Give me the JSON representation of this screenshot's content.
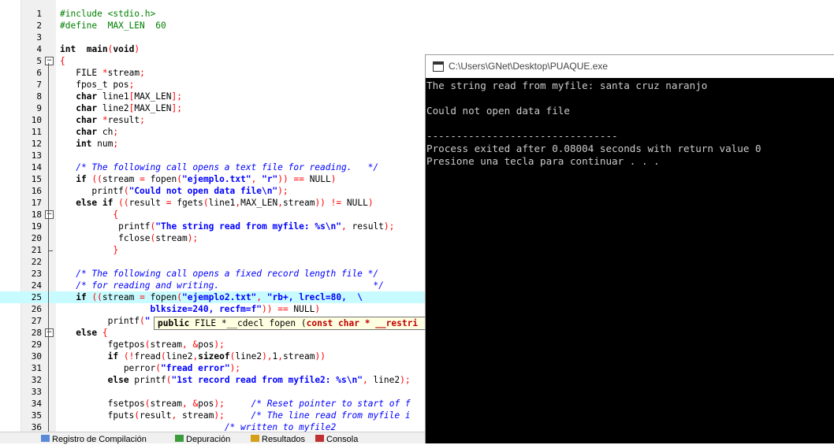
{
  "editor": {
    "lines": [
      {
        "n": "1",
        "segs": [
          [
            "pp",
            "#include <stdio.h>"
          ]
        ]
      },
      {
        "n": "2",
        "segs": [
          [
            "pp",
            "#define  MAX_LEN  60"
          ]
        ]
      },
      {
        "n": "3",
        "segs": []
      },
      {
        "n": "4",
        "segs": [
          [
            "kw",
            "int"
          ],
          [
            "",
            "  "
          ],
          [
            "kw",
            "main"
          ],
          [
            "sym",
            "("
          ],
          [
            "kw",
            "void"
          ],
          [
            "sym",
            ")"
          ]
        ]
      },
      {
        "n": "5",
        "segs": [
          [
            "sym",
            "{"
          ]
        ]
      },
      {
        "n": "6",
        "segs": [
          [
            "",
            "   FILE "
          ],
          [
            "sym",
            "*"
          ],
          [
            "",
            "stream"
          ],
          [
            "sym",
            ";"
          ]
        ]
      },
      {
        "n": "7",
        "segs": [
          [
            "",
            "   fpos_t pos"
          ],
          [
            "sym",
            ";"
          ]
        ]
      },
      {
        "n": "8",
        "segs": [
          [
            "kw",
            "   char"
          ],
          [
            "",
            " line1"
          ],
          [
            "sym",
            "["
          ],
          [
            "",
            "MAX_LEN"
          ],
          [
            "sym",
            "];"
          ]
        ]
      },
      {
        "n": "9",
        "segs": [
          [
            "kw",
            "   char"
          ],
          [
            "",
            " line2"
          ],
          [
            "sym",
            "["
          ],
          [
            "",
            "MAX_LEN"
          ],
          [
            "sym",
            "];"
          ]
        ]
      },
      {
        "n": "10",
        "segs": [
          [
            "kw",
            "   char"
          ],
          [
            "",
            " "
          ],
          [
            "sym",
            "*"
          ],
          [
            "",
            "result"
          ],
          [
            "sym",
            ";"
          ]
        ]
      },
      {
        "n": "11",
        "segs": [
          [
            "kw",
            "   char"
          ],
          [
            "",
            " ch"
          ],
          [
            "sym",
            ";"
          ]
        ]
      },
      {
        "n": "12",
        "segs": [
          [
            "kw",
            "   int"
          ],
          [
            "",
            " num"
          ],
          [
            "sym",
            ";"
          ]
        ]
      },
      {
        "n": "13",
        "segs": []
      },
      {
        "n": "14",
        "segs": [
          [
            "cm",
            "   /* The following call opens a text file for reading.   */"
          ]
        ]
      },
      {
        "n": "15",
        "segs": [
          [
            "kw",
            "   if"
          ],
          [
            "",
            " "
          ],
          [
            "sym",
            "(("
          ],
          [
            "",
            "stream "
          ],
          [
            "sym",
            "="
          ],
          [
            "",
            " fopen"
          ],
          [
            "sym",
            "("
          ],
          [
            "str",
            "\"ejemplo.txt\""
          ],
          [
            "sym",
            ","
          ],
          [
            "",
            " "
          ],
          [
            "str",
            "\"r\""
          ],
          [
            "sym",
            "))"
          ],
          [
            "",
            " "
          ],
          [
            "sym",
            "=="
          ],
          [
            "",
            " NULL"
          ],
          [
            "sym",
            ")"
          ]
        ]
      },
      {
        "n": "16",
        "segs": [
          [
            "",
            "      printf"
          ],
          [
            "sym",
            "("
          ],
          [
            "str",
            "\"Could not open data file\\n\""
          ],
          [
            "sym",
            ");"
          ]
        ]
      },
      {
        "n": "17",
        "segs": [
          [
            "kw",
            "   else if"
          ],
          [
            "",
            " "
          ],
          [
            "sym",
            "(("
          ],
          [
            "",
            "result "
          ],
          [
            "sym",
            "="
          ],
          [
            "",
            " fgets"
          ],
          [
            "sym",
            "("
          ],
          [
            "",
            "line1"
          ],
          [
            "sym",
            ","
          ],
          [
            "",
            "MAX_LEN"
          ],
          [
            "sym",
            ","
          ],
          [
            "",
            "stream"
          ],
          [
            "sym",
            "))"
          ],
          [
            "",
            " "
          ],
          [
            "sym",
            "!="
          ],
          [
            "",
            " NULL"
          ],
          [
            "sym",
            ")"
          ]
        ]
      },
      {
        "n": "18",
        "segs": [
          [
            "",
            "          "
          ],
          [
            "sym",
            "{"
          ]
        ]
      },
      {
        "n": "19",
        "segs": [
          [
            "",
            "           printf"
          ],
          [
            "sym",
            "("
          ],
          [
            "str",
            "\"The string read from myfile: %s\\n\""
          ],
          [
            "sym",
            ","
          ],
          [
            "",
            " result"
          ],
          [
            "sym",
            ");"
          ]
        ]
      },
      {
        "n": "20",
        "segs": [
          [
            "",
            "           fclose"
          ],
          [
            "sym",
            "("
          ],
          [
            "",
            "stream"
          ],
          [
            "sym",
            ");"
          ]
        ]
      },
      {
        "n": "21",
        "segs": [
          [
            "",
            "          "
          ],
          [
            "sym",
            "}"
          ]
        ]
      },
      {
        "n": "22",
        "segs": []
      },
      {
        "n": "23",
        "segs": [
          [
            "cm",
            "   /* The following call opens a fixed record length file */"
          ]
        ]
      },
      {
        "n": "24",
        "segs": [
          [
            "cm",
            "   /* for reading and writing.                             */"
          ]
        ]
      },
      {
        "n": "25",
        "segs": [
          [
            "kw",
            "   if"
          ],
          [
            "",
            " "
          ],
          [
            "sym",
            "(("
          ],
          [
            "",
            "stream "
          ],
          [
            "sym",
            "="
          ],
          [
            "",
            " fopen"
          ],
          [
            "sym",
            "("
          ],
          [
            "str",
            "\"ejemplo2.txt\""
          ],
          [
            "sym",
            ","
          ],
          [
            "",
            " "
          ],
          [
            "str",
            "\"rb+, lrecl=80,  \\"
          ]
        ]
      },
      {
        "n": "26",
        "segs": [
          [
            "",
            "                 "
          ],
          [
            "str",
            "blksize=240, recfm=f\""
          ],
          [
            "sym",
            "))"
          ],
          [
            "",
            " "
          ],
          [
            "sym",
            "=="
          ],
          [
            "",
            " NULL"
          ],
          [
            "sym",
            ")"
          ]
        ]
      },
      {
        "n": "27",
        "segs": [
          [
            "",
            "         printf"
          ],
          [
            "sym",
            "("
          ],
          [
            "str",
            "\""
          ]
        ]
      },
      {
        "n": "28",
        "segs": [
          [
            "kw",
            "   else"
          ],
          [
            "",
            " "
          ],
          [
            "sym",
            "{"
          ]
        ]
      },
      {
        "n": "29",
        "segs": [
          [
            "",
            "         fgetpos"
          ],
          [
            "sym",
            "("
          ],
          [
            "",
            "stream"
          ],
          [
            "sym",
            ","
          ],
          [
            "",
            " "
          ],
          [
            "sym",
            "&"
          ],
          [
            "",
            "pos"
          ],
          [
            "sym",
            ");"
          ]
        ]
      },
      {
        "n": "30",
        "segs": [
          [
            "kw",
            "         if"
          ],
          [
            "",
            " "
          ],
          [
            "sym",
            "(!"
          ],
          [
            "",
            "fread"
          ],
          [
            "sym",
            "("
          ],
          [
            "",
            "line2"
          ],
          [
            "sym",
            ","
          ],
          [
            "kw",
            "sizeof"
          ],
          [
            "sym",
            "("
          ],
          [
            "",
            "line2"
          ],
          [
            "sym",
            "),"
          ],
          [
            "",
            "1"
          ],
          [
            "sym",
            ","
          ],
          [
            "",
            "stream"
          ],
          [
            "sym",
            "))"
          ]
        ]
      },
      {
        "n": "31",
        "segs": [
          [
            "",
            "            perror"
          ],
          [
            "sym",
            "("
          ],
          [
            "str",
            "\"fread error\""
          ],
          [
            "sym",
            ");"
          ]
        ]
      },
      {
        "n": "32",
        "segs": [
          [
            "kw",
            "         else"
          ],
          [
            "",
            " printf"
          ],
          [
            "sym",
            "("
          ],
          [
            "str",
            "\"1st record read from myfile2: %s\\n\""
          ],
          [
            "sym",
            ","
          ],
          [
            "",
            " line2"
          ],
          [
            "sym",
            ");"
          ]
        ]
      },
      {
        "n": "33",
        "segs": []
      },
      {
        "n": "34",
        "segs": [
          [
            "",
            "         fsetpos"
          ],
          [
            "sym",
            "("
          ],
          [
            "",
            "stream"
          ],
          [
            "sym",
            ","
          ],
          [
            "",
            " "
          ],
          [
            "sym",
            "&"
          ],
          [
            "",
            "pos"
          ],
          [
            "sym",
            ");"
          ],
          [
            "",
            "     "
          ],
          [
            "cm",
            "/* Reset pointer to start of f"
          ]
        ]
      },
      {
        "n": "35",
        "segs": [
          [
            "",
            "         fputs"
          ],
          [
            "sym",
            "("
          ],
          [
            "",
            "result"
          ],
          [
            "sym",
            ","
          ],
          [
            "",
            " stream"
          ],
          [
            "sym",
            ");"
          ],
          [
            "",
            "     "
          ],
          [
            "cm",
            "/* The line read from myfile i"
          ]
        ]
      },
      {
        "n": "36",
        "segs": [
          [
            "",
            "                               "
          ],
          [
            "cm",
            "/* written to myfile2"
          ]
        ]
      }
    ]
  },
  "tooltip": {
    "kw1": "public",
    "mid": " FILE *__cdecl fopen (",
    "kw2": "const char",
    "rest": " * __restri"
  },
  "bottom_tabs": [
    {
      "label": "Registro de Compilación"
    },
    {
      "label": "Depuración"
    },
    {
      "label": "Resultados"
    },
    {
      "label": "Consola"
    }
  ],
  "console": {
    "title": "C:\\Users\\GNet\\Desktop\\PUAQUE.exe",
    "lines": [
      "The string read from myfile: santa cruz naranjo",
      "",
      "Could not open data file",
      "",
      "--------------------------------",
      "Process exited after 0.08004 seconds with return value 0",
      "Presione una tecla para continuar . . ."
    ]
  }
}
